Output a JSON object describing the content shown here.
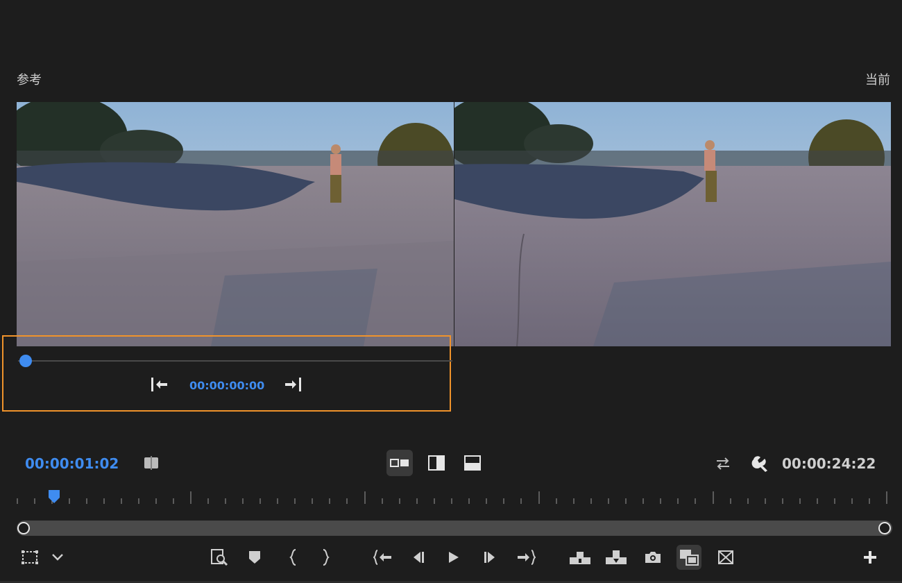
{
  "labels": {
    "reference": "参考",
    "current": "当前"
  },
  "reference_player": {
    "timecode": "00:00:00:00",
    "progress": 0.0
  },
  "program": {
    "current_timecode": "00:00:01:02",
    "duration": "00:00:24:22"
  },
  "compare_modes": [
    "side-by-side",
    "vertical-split",
    "horizontal-split"
  ],
  "active_compare_mode": "side-by-side",
  "colors": {
    "accent": "#3f8cf0",
    "highlight_box": "#f0932b",
    "background": "#1d1d1d"
  },
  "toolbar_icons": [
    "transform-icon",
    "chevron-down-icon",
    "zoom-to-sequence-icon",
    "marker-icon",
    "mark-in-icon",
    "mark-out-icon",
    "go-to-in-icon",
    "step-back-icon",
    "play-icon",
    "step-forward-icon",
    "go-to-out-icon",
    "insert-icon",
    "overwrite-icon",
    "export-frame-icon",
    "comparison-view-icon",
    "multicam-icon",
    "add-button-icon"
  ]
}
